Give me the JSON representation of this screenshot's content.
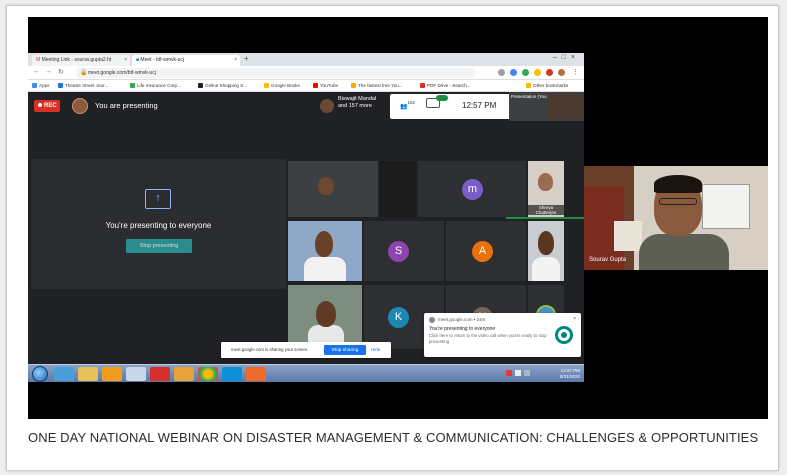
{
  "browser": {
    "tabs": [
      {
        "label": "Meeting Link - sourav.gupta2.ht",
        "icon_color": "#d93025"
      },
      {
        "label": "Meet - btf-wmvk-ucj",
        "icon_color": "#00897b"
      }
    ],
    "url": "meet.google.com/btf-wmvk-ucj",
    "bookmarks": [
      {
        "label": "Apps",
        "color": "#4285f4"
      },
      {
        "label": "Theatre Street Jour...",
        "color": "#1a73e8"
      },
      {
        "label": "Life Insurance Corp...",
        "color": "#34a853"
      },
      {
        "label": "Online Shopping S...",
        "color": "#202124"
      },
      {
        "label": "Google Books",
        "color": "#fbbc04"
      },
      {
        "label": "YouTube",
        "color": "#ff0000"
      },
      {
        "label": "The fastest free You...",
        "color": "#f9ab00"
      },
      {
        "label": "PDF Drive - Search...",
        "color": "#d93025"
      },
      {
        "label": "Other bookmarks",
        "color": "#fbbc04"
      }
    ]
  },
  "meet": {
    "rec_label": "REC",
    "presenting_label": "You are presenting",
    "viewer_line1": "Biswajit Mandal",
    "viewer_line2": "and 157 more",
    "participant_count": "162",
    "chat_badge": "",
    "clock": "12:57 PM",
    "presentation_label": "Presentation (You)",
    "present_message": "You're presenting to everyone",
    "stop_presenting_label": "Stop presenting",
    "tiles": [
      {
        "letter": "m",
        "color": "#7b5cc9"
      },
      {
        "letter": "S",
        "color": "#8e44ad"
      },
      {
        "letter": "A",
        "color": "#e8710a"
      },
      {
        "letter": "K",
        "color": "#1e88b5"
      },
      {
        "letter": "N",
        "color": "#7a6459"
      }
    ],
    "chatterjee_label": "Shreya Chatterjee"
  },
  "notification": {
    "source": "meet.google.com • 24m",
    "title": "You're presenting to everyone",
    "message": "Click here to return to the video call when you're ready to stop presenting",
    "close_label": "×"
  },
  "sharebar": {
    "text": "meet.google.com is sharing your screen.",
    "stop_label": "Stop sharing",
    "hide_label": "Hide"
  },
  "taskbar": {
    "time": "12:57 PM",
    "date": "8/31/2020"
  },
  "webcam": {
    "name": "Sourav Gupta"
  },
  "caption": {
    "text": "ONE DAY NATIONAL WEBINAR ON DISASTER MANAGEMENT & COMMUNICATION: CHALLENGES & OPPORTUNITIES"
  }
}
